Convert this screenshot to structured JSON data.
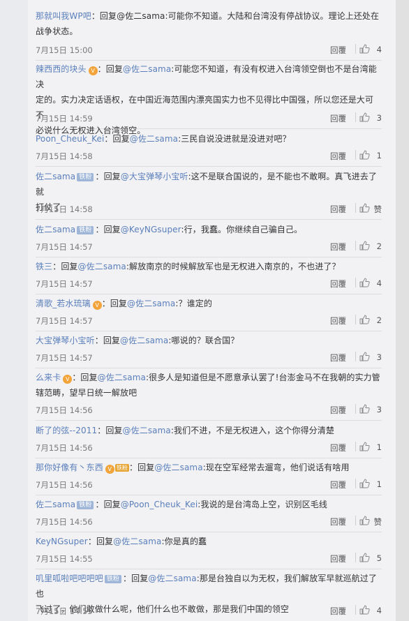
{
  "ui": {
    "reply_label": "回复",
    "reply_btn": "回覆"
  },
  "comments": [
    {
      "user": "那就叫我WP吧",
      "text_lines": [
        "回复@佐二sama:可能你不知道。大陆和台湾没有停战协议。理论上还处在",
        "战争状态。"
      ],
      "reply_to": "@佐二sama",
      "time": "7月15日 15:00",
      "likes": "4",
      "badge": ""
    },
    {
      "user": "辣西西的块头",
      "text_lines": [
        "可能您不知道，有没有权进入台湾领空倒也不是台湾能决",
        "定的。实力决定话语权，在中国近海范围内漂亮国实力也不见得比中国强，所以您还是大可不",
        "必说什么无权进入台湾领空。"
      ],
      "reply_to": "@佐二sama",
      "time": "7月15日 14:59",
      "likes": "3",
      "badge": "vip"
    },
    {
      "user": "Poon_Cheuk_Kei",
      "text_lines": [
        "三民自说没进就是没进对吧？"
      ],
      "reply_to": "@佐二sama",
      "time": "7月15日 14:58",
      "likes": "1",
      "badge": ""
    },
    {
      "user": "佐二sama",
      "text_lines": [
        "这不是联合国说的，是不能也不敢啊。真飞进去了就",
        "打仗了"
      ],
      "reply_to": "@大宝弹琴小宝听",
      "time": "7月15日 14:58",
      "likes": "赞",
      "badge": "fan"
    },
    {
      "user": "佐二sama",
      "text_lines": [
        "行，我蠢。你继续自己骗自己。"
      ],
      "reply_to": "@KeyNGsuper",
      "time": "7月15日 14:57",
      "likes": "2",
      "badge": "fan"
    },
    {
      "user": "铁三",
      "text_lines": [
        "解放南京的时候解放军也是无权进入南京的，不也进了？"
      ],
      "reply_to": "@佐二sama",
      "time": "7月15日 14:57",
      "likes": "4",
      "badge": ""
    },
    {
      "user": "清歌_若水琉璃",
      "text_lines": [
        "？谁定的"
      ],
      "reply_to": "@佐二sama",
      "time": "7月15日 14:57",
      "likes": "2",
      "badge": "vip"
    },
    {
      "user": "大宝弹琴小宝听",
      "text_lines": [
        "哪说的？联合国？"
      ],
      "reply_to": "@佐二sama",
      "time": "7月15日 14:57",
      "likes": "3",
      "badge": ""
    },
    {
      "user": "么来卡",
      "text_lines": [
        "很多人是知道但是不愿意承认罢了!台澎金马不在我朝的实力管",
        "辖范畴，望早日统一解放吧"
      ],
      "reply_to": "@佐二sama",
      "time": "7月15日 14:56",
      "likes": "3",
      "badge": "vip"
    },
    {
      "user": "断了的弦--2011",
      "text_lines": [
        "我们不进，不是无权进入，这个你得分清楚"
      ],
      "reply_to": "@佐二sama",
      "time": "7月15日 14:56",
      "likes": "1",
      "badge": ""
    },
    {
      "user": "那你好像有丶东西",
      "text_lines": [
        "现在空军经常去遛弯，他们说话有啥用"
      ],
      "reply_to": "@佐二sama",
      "time": "7月15日 14:56",
      "likes": "1",
      "badge": "vipfan"
    },
    {
      "user": "佐二sama",
      "text_lines": [
        "我说的是台湾岛上空，识别区毛线"
      ],
      "reply_to": "@Poon_Cheuk_Kei",
      "time": "7月15日 14:56",
      "likes": "赞",
      "badge": "fan"
    },
    {
      "user": "KeyNGsuper",
      "text_lines": [
        "你是真的蠢"
      ],
      "reply_to": "@佐二sama",
      "time": "7月15日 14:55",
      "likes": "5",
      "badge": ""
    },
    {
      "user": "叽里呱啦吧吧吧吧",
      "text_lines": [
        "那是台独自以为无权，我们解放军早就巡航过了也",
        "飞过了，他们敢做什么呢，他们什么也不敢做，那是我们中国的领空"
      ],
      "reply_to": "@佐二sama",
      "time": "7月15日 14:55",
      "likes": "4",
      "badge": "fan"
    }
  ],
  "badges": {
    "fan": "铁粉",
    "vip": "V"
  }
}
